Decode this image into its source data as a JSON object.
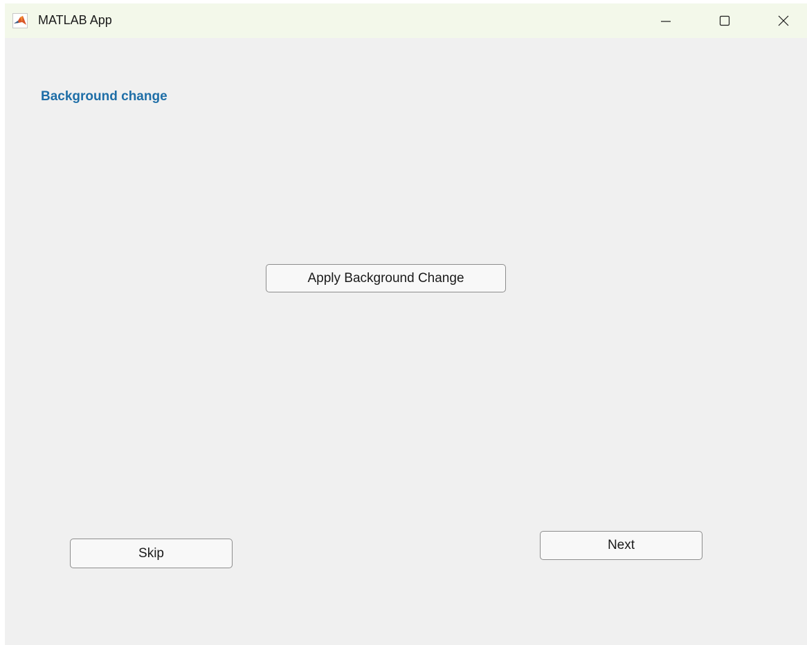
{
  "window": {
    "title": "MATLAB App",
    "app_icon": "matlab-membrane-icon",
    "controls": {
      "minimize_icon": "minimize-icon",
      "maximize_icon": "maximize-icon",
      "close_icon": "close-icon"
    }
  },
  "main": {
    "heading": "Background change",
    "apply_button_label": "Apply Background Change",
    "skip_button_label": "Skip",
    "next_button_label": "Next"
  },
  "colors": {
    "heading": "#1e6ea7",
    "titlebar": "#f3f8ea",
    "window_background": "#f0f0f0",
    "button_border": "#8c8c8c"
  }
}
